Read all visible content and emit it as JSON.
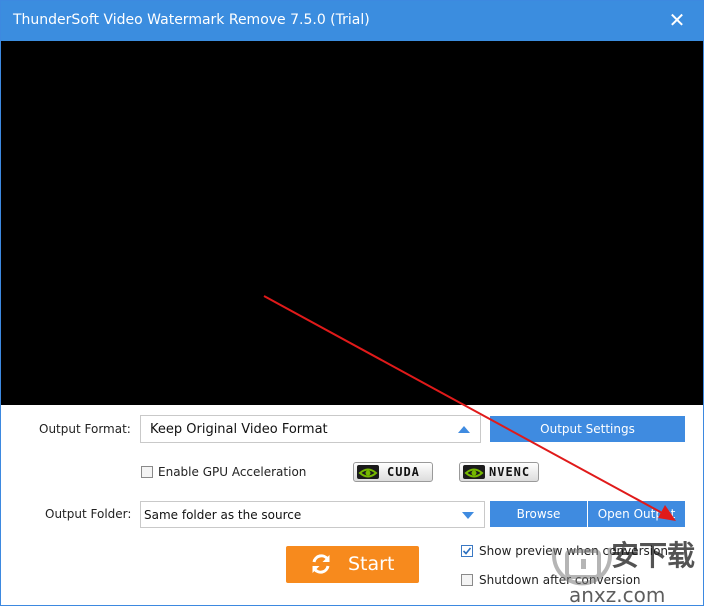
{
  "window": {
    "title": "ThunderSoft Video Watermark Remove 7.5.0 (Trial)",
    "close_glyph": "✕"
  },
  "output_format": {
    "label": "Output Format:",
    "value": "Keep Original Video Format",
    "settings_button": "Output Settings"
  },
  "gpu": {
    "label": "Enable GPU Acceleration",
    "checked": false,
    "badges": [
      "CUDA",
      "NVENC"
    ]
  },
  "output_folder": {
    "label": "Output Folder:",
    "value": "Same folder as the source",
    "browse_button": "Browse",
    "open_button": "Open Output"
  },
  "start_button": "Start",
  "options": {
    "show_preview": {
      "label": "Show preview when conversion",
      "checked": true
    },
    "shutdown": {
      "label": "Shutdown after conversion",
      "checked": false
    }
  },
  "watermark": {
    "chinese": "安下载",
    "domain": "anxz.com"
  },
  "colors": {
    "titlebar": "#3b8ddf",
    "accent_blue": "#3f8be0",
    "start_orange": "#f78a1d",
    "annotation_red": "#e01a1a"
  },
  "icons": {
    "close": "close-icon",
    "dropdown": "dropdown-arrow-icon",
    "start": "refresh-icon",
    "gpu": "nvidia-logo-icon"
  }
}
